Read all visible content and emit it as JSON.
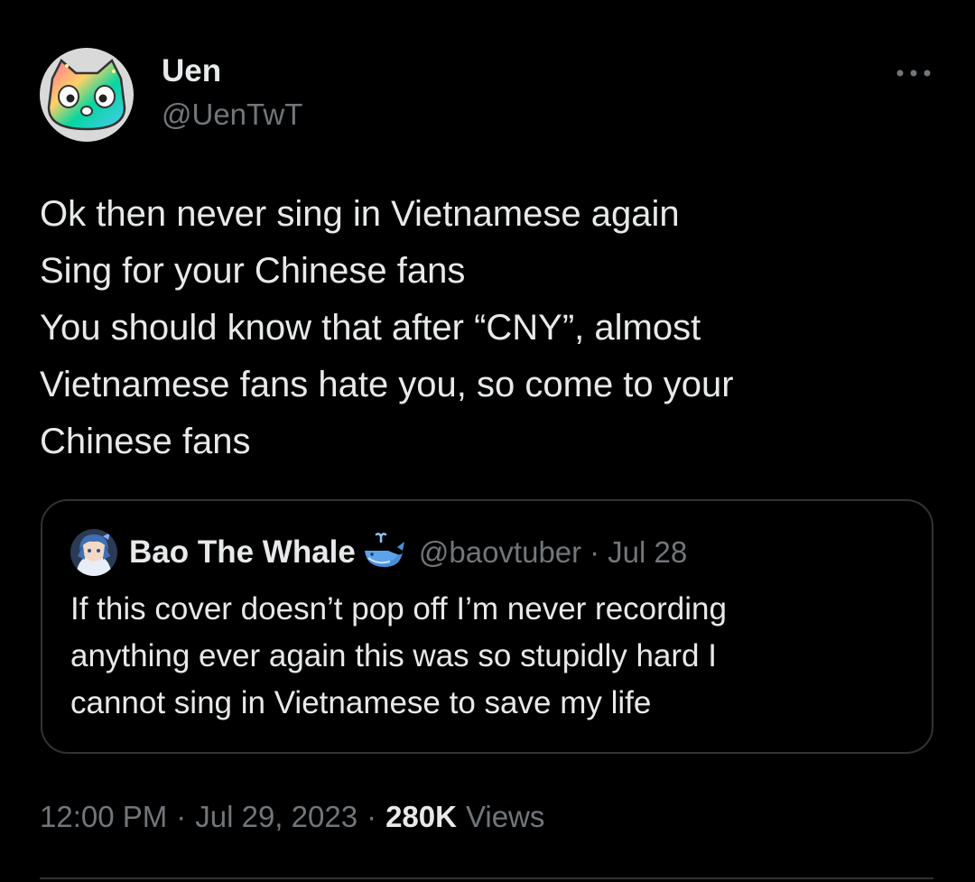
{
  "tweet": {
    "author": {
      "display_name": "Uen",
      "handle": "@UenTwT",
      "avatar_icon": "cat-face-avatar"
    },
    "more_icon": "more-horizontal-icon",
    "text_lines": [
      "Ok then never sing in Vietnamese again",
      "Sing for your Chinese fans",
      "You should know that after “CNY”, almost",
      "Vietnamese fans hate you, so come to your",
      "Chinese fans"
    ],
    "quoted": {
      "display_name": "Bao The Whale",
      "badge_icon": "whale-icon",
      "handle": "@baovtuber",
      "separator": "·",
      "date": "Jul 28",
      "text_lines": [
        "If this cover doesn’t pop off I’m never recording",
        "anything ever again this was so stupidly hard I",
        "cannot sing in Vietnamese to save my life"
      ]
    },
    "meta": {
      "time": "12:00 PM",
      "separator": "·",
      "date": "Jul 29, 2023",
      "views_count": "280K",
      "views_label": "Views"
    }
  },
  "colors": {
    "background": "#000000",
    "text_primary": "#e7e9ea",
    "text_secondary": "#71767b",
    "border": "#2f3336",
    "whale_blue": "#5b9bd5"
  }
}
